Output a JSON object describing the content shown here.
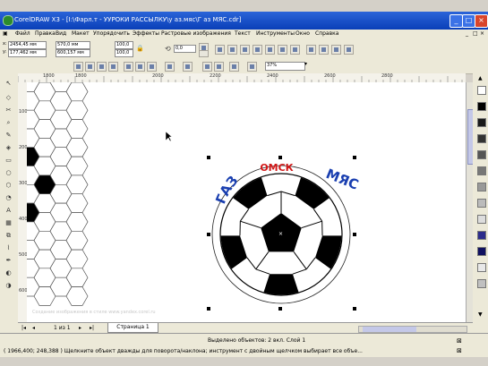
{
  "window": {
    "title": "CorelDRAW X3 - [I:\\Фарл.т - УУРОКИ РАССЫЛКУ\\у аз.мяс\\Г аз МЯС.cdr]",
    "minimize": "_",
    "maximize": "□",
    "close": "×"
  },
  "menu": {
    "items": [
      "Файл",
      "Правка",
      "Вид",
      "Макет",
      "Упорядочить",
      "Эффекты",
      "Растровые изображения",
      "Текст",
      "Инструменты",
      "Окно",
      "Справка"
    ]
  },
  "propbar": {
    "x": "2454,45 мм",
    "y": "177,462 мм",
    "w": "570,0 мм",
    "h": "600,157 мм",
    "scale_w": "100,0",
    "scale_h": "100,0",
    "angle": "0,0"
  },
  "stdbar": {
    "zoom": "37%"
  },
  "rulers": {
    "h_labels": [
      "1800",
      "1800",
      "2000",
      "2200",
      "2400",
      "2600",
      "2800"
    ],
    "v_labels": [
      "100",
      "200",
      "300",
      "400",
      "500",
      "600"
    ]
  },
  "artwork": {
    "arc_left": "ГАЗ",
    "arc_mid": "ОМСК",
    "arc_right": "МЯС",
    "left_color": "#1a3fb0",
    "mid_color": "#d21818"
  },
  "pagebar": {
    "count": "1 из 1",
    "tab": "Страница 1"
  },
  "status": {
    "selection": "Выделено объектов: 2 вкл. Слой 1",
    "hint": "( 1966,400; 248,388 )  Щелкните объект дважды для поворота/наклона; инструмент с двойным щелчком выбирает все объе..."
  },
  "watermark": "Создание изображения в стиле www.yandex.corel.ru",
  "palette_colors": [
    "#ffffff",
    "#000000",
    "#1a1a1a",
    "#333333",
    "#555555",
    "#777777",
    "#999999",
    "#bbbbbb",
    "#dddddd",
    "#2c2c8c",
    "#101060",
    "#e8e8e8",
    "#c0c0c0"
  ]
}
